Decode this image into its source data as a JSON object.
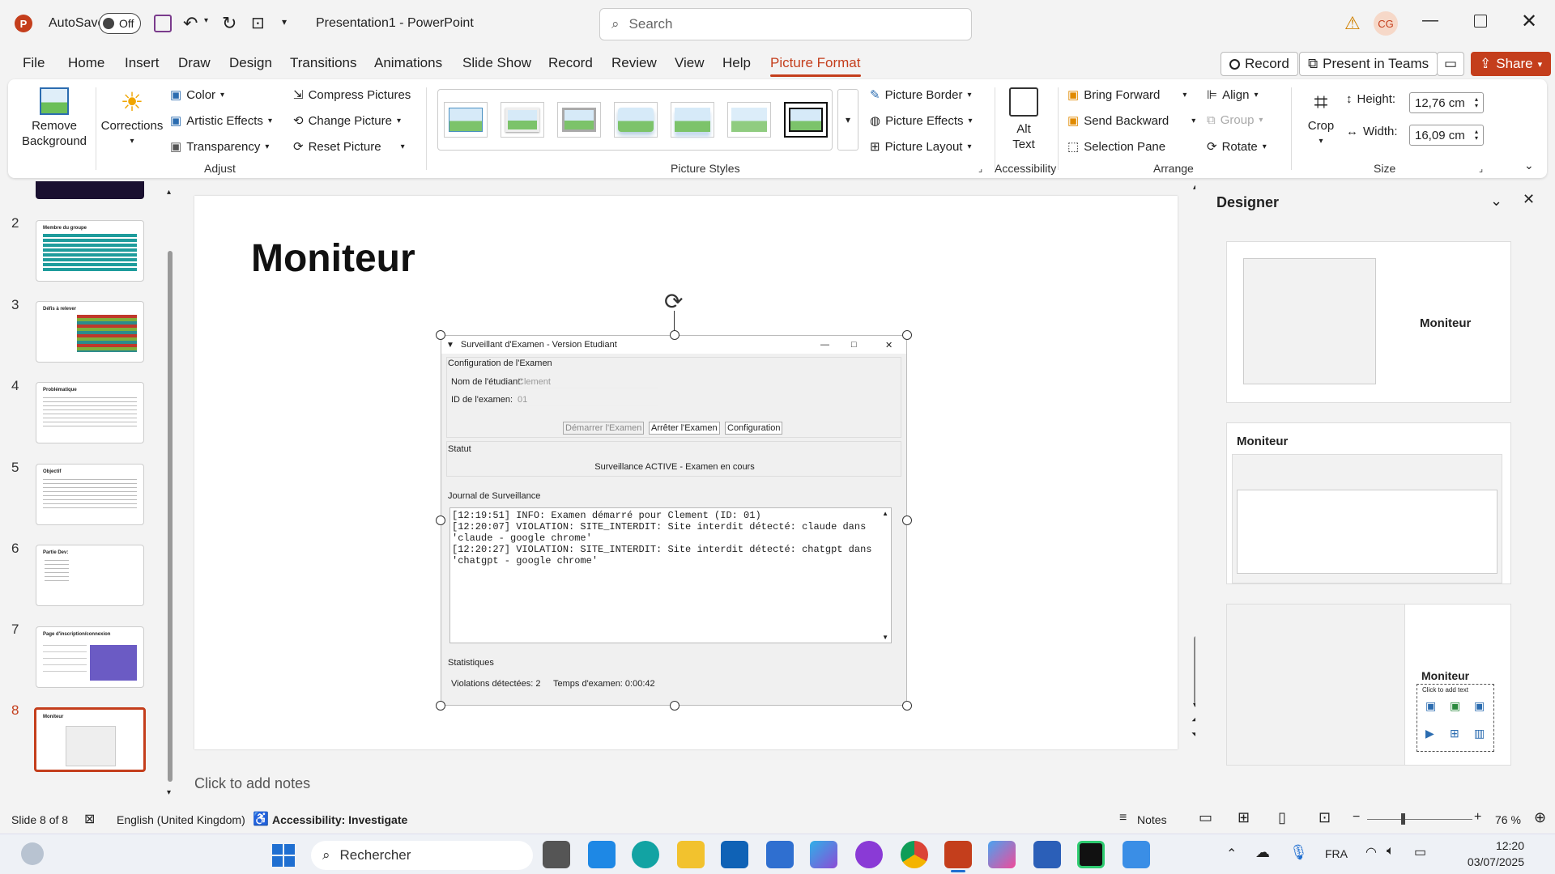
{
  "titlebar": {
    "app_icon": "powerpoint-icon",
    "autosave_label": "AutoSave",
    "autosave_state": "Off",
    "doc_title": "Presentation1  -  PowerPoint",
    "search_placeholder": "Search",
    "user_initials": "CG"
  },
  "menu": {
    "items": [
      "File",
      "Home",
      "Insert",
      "Draw",
      "Design",
      "Transitions",
      "Animations",
      "Slide Show",
      "Record",
      "Review",
      "View",
      "Help",
      "Picture Format"
    ],
    "active": "Picture Format",
    "record_btn": "Record",
    "present_btn": "Present in Teams",
    "share_btn": "Share"
  },
  "ribbon": {
    "remove_bg": "Remove Background",
    "corrections": "Corrections",
    "color": "Color",
    "artistic": "Artistic Effects",
    "transparency": "Transparency",
    "compress": "Compress Pictures",
    "change": "Change Picture",
    "reset": "Reset Picture",
    "group_adjust": "Adjust",
    "group_styles": "Picture Styles",
    "border": "Picture Border",
    "effects": "Picture Effects",
    "layout": "Picture Layout",
    "alt_text": "Alt Text",
    "group_access": "Accessibility",
    "bring_forward": "Bring Forward",
    "send_backward": "Send Backward",
    "selection_pane": "Selection Pane",
    "align": "Align",
    "group": "Group",
    "rotate": "Rotate",
    "group_arrange": "Arrange",
    "crop": "Crop",
    "height_label": "Height:",
    "height_value": "12,76 cm",
    "width_label": "Width:",
    "width_value": "16,09 cm",
    "group_size": "Size"
  },
  "thumbnails": [
    {
      "num": "2",
      "title": "Membre du groupe"
    },
    {
      "num": "3",
      "title": "Défis à relever"
    },
    {
      "num": "4",
      "title": "Problématique"
    },
    {
      "num": "5",
      "title": "Objectif"
    },
    {
      "num": "6",
      "title": "Partie Dev:"
    },
    {
      "num": "7",
      "title": "Page d'inscription/connexion"
    },
    {
      "num": "8",
      "title": "Moniteur"
    }
  ],
  "slide": {
    "title": "Moniteur",
    "window_title": "Surveillant d'Examen - Version Etudiant",
    "config_header": "Configuration de l'Examen",
    "student_label": "Nom de l'étudiant:",
    "student_value": "Clement",
    "exam_label": "ID de l'examen:",
    "exam_value": "01",
    "btn_start": "Démarrer l'Examen",
    "btn_stop": "Arrêter l'Examen",
    "btn_config": "Configuration",
    "status_header": "Statut",
    "status_value": "Surveillance ACTIVE - Examen en cours",
    "journal_header": "Journal de Surveillance",
    "log1": "[12:19:51] INFO: Examen démarré pour Clement (ID: 01)",
    "log2": "[12:20:07] VIOLATION: SITE_INTERDIT: Site interdit détecté: claude dans 'claude - google chrome'",
    "log3": "[12:20:27] VIOLATION: SITE_INTERDIT: Site interdit détecté: chatgpt dans 'chatgpt - google chrome'",
    "stats_header": "Statistiques",
    "violations": "Violations détectées: 2",
    "exam_time": "Temps d'examen: 0:00:42"
  },
  "notes_placeholder": "Click to add notes",
  "designer": {
    "title": "Designer",
    "card_title": "Moniteur",
    "click_add_text": "Click to add text"
  },
  "status": {
    "slide_info": "Slide 8 of 8",
    "language": "English (United Kingdom)",
    "accessibility": "Accessibility: Investigate",
    "notes": "Notes",
    "zoom": "76 %"
  },
  "taskbar": {
    "search": "Rechercher",
    "lang": "FRA",
    "time": "12:20",
    "date": "03/07/2025"
  },
  "colors": {
    "accent": "#c43e1c",
    "ppt_red": "#c43e1c"
  }
}
